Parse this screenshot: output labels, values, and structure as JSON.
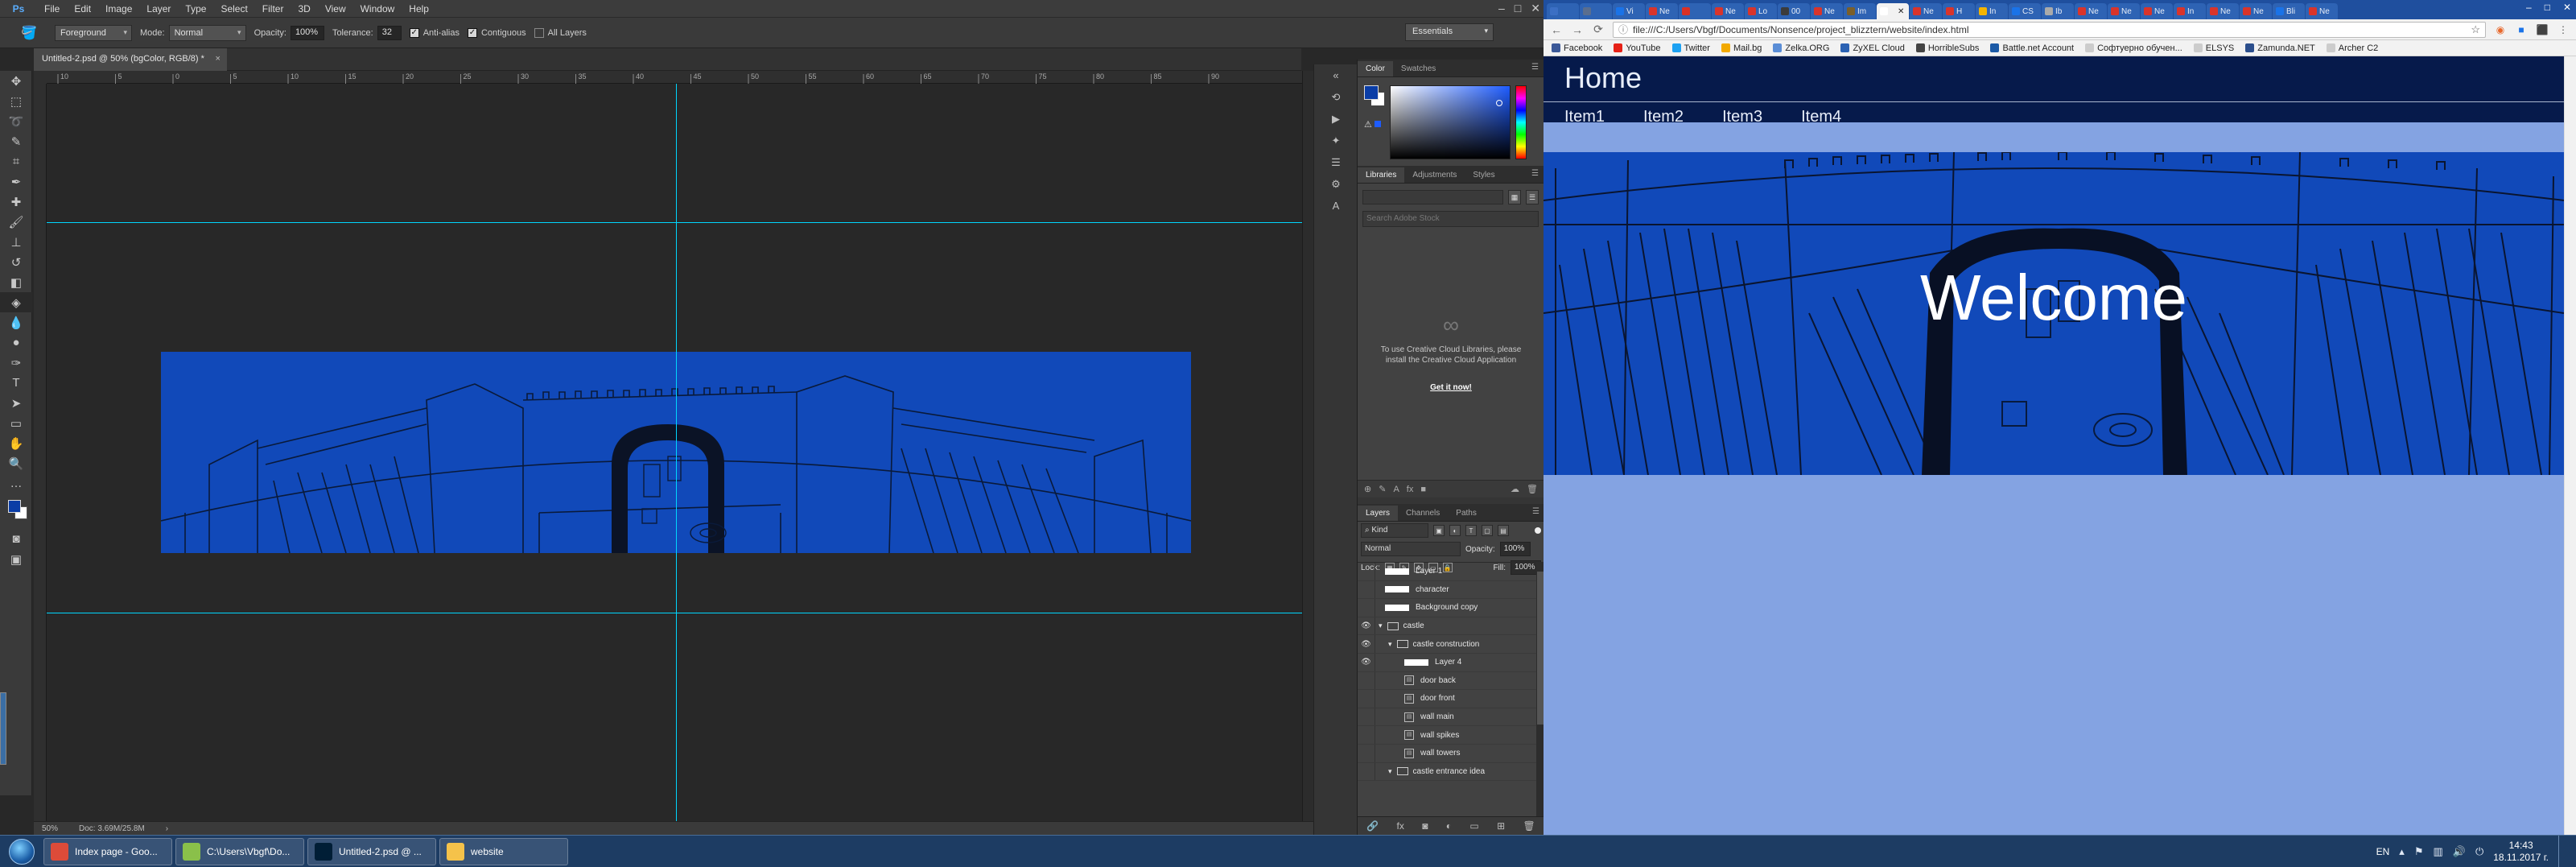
{
  "photoshop": {
    "menu": [
      "File",
      "Edit",
      "Image",
      "Layer",
      "Type",
      "Select",
      "Filter",
      "3D",
      "View",
      "Window",
      "Help"
    ],
    "options": {
      "fill_source": "Foreground",
      "mode_label": "Mode:",
      "mode_value": "Normal",
      "opacity_label": "Opacity:",
      "opacity_value": "100%",
      "tolerance_label": "Tolerance:",
      "tolerance_value": "32",
      "anti_alias": "Anti-alias",
      "contiguous": "Contiguous",
      "all_layers": "All Layers",
      "workspace": "Essentials"
    },
    "document_tab": "Untitled-2.psd @ 50% (bgColor, RGB/8) *",
    "document_tab_close": "×",
    "ruler_top_ticks": [
      "10",
      "5",
      "0",
      "5",
      "10",
      "15",
      "20",
      "25",
      "30",
      "35",
      "40",
      "45",
      "50",
      "55",
      "60",
      "65",
      "70",
      "75",
      "80",
      "85",
      "90"
    ],
    "status": {
      "zoom": "50%",
      "doc": "Doc: 3.69M/25.8M"
    },
    "color_panel": {
      "tabs": [
        "Color",
        "Swatches"
      ],
      "foreground": "#0a3da6",
      "background": "#ffffff"
    },
    "libraries_panel": {
      "tabs": [
        "Libraries",
        "Adjustments",
        "Styles"
      ],
      "search_placeholder": "Search Adobe Stock",
      "message": "To use Creative Cloud Libraries, please install the Creative Cloud Application",
      "link": "Get it now!"
    },
    "layers_panel": {
      "tabs": [
        "Layers",
        "Channels",
        "Paths"
      ],
      "kind": "Kind",
      "blend_mode": "Normal",
      "opacity_label": "Opacity:",
      "opacity_value": "100%",
      "lock_label": "Lock:",
      "fill_label": "Fill:",
      "fill_value": "100%",
      "layers": [
        {
          "name": "Layer 1",
          "visible": false,
          "kind": "pixel",
          "indent": 0
        },
        {
          "name": "character",
          "visible": false,
          "kind": "pixel",
          "indent": 0
        },
        {
          "name": "Background copy",
          "visible": false,
          "kind": "pixel",
          "indent": 0
        },
        {
          "name": "castle",
          "visible": true,
          "kind": "group",
          "indent": 0
        },
        {
          "name": "castle construction",
          "visible": true,
          "kind": "group",
          "indent": 1
        },
        {
          "name": "Layer 4",
          "visible": true,
          "kind": "pixel",
          "indent": 2
        },
        {
          "name": "door back",
          "visible": false,
          "kind": "smart",
          "indent": 2
        },
        {
          "name": "door front",
          "visible": false,
          "kind": "smart",
          "indent": 2
        },
        {
          "name": "wall main",
          "visible": false,
          "kind": "smart",
          "indent": 2
        },
        {
          "name": "wall spikes",
          "visible": false,
          "kind": "smart",
          "indent": 2
        },
        {
          "name": "wall towers",
          "visible": false,
          "kind": "smart",
          "indent": 2
        },
        {
          "name": "castle entrance idea",
          "visible": false,
          "kind": "group",
          "indent": 1
        }
      ]
    }
  },
  "chrome": {
    "address": "file:///C:/Users/Vbgf/Documents/Nonsence/project_blizztern/website/index.html",
    "tabs": [
      {
        "label": "",
        "color": "#3b6fc4"
      },
      {
        "label": "",
        "color": "#5a6e8f"
      },
      {
        "label": "Vi",
        "color": "#1a73e8"
      },
      {
        "label": "Ne",
        "color": "#d9342b"
      },
      {
        "label": "",
        "color": "#d93025"
      },
      {
        "label": "Ne",
        "color": "#d9342b"
      },
      {
        "label": "Lo",
        "color": "#d9342b"
      },
      {
        "label": "00",
        "color": "#3b3b3b"
      },
      {
        "label": "Ne",
        "color": "#d9342b"
      },
      {
        "label": "Im",
        "color": "#7a5f2a"
      },
      {
        "label": "",
        "color": "#ffffff"
      },
      {
        "label": "Ne",
        "color": "#d9342b"
      },
      {
        "label": "H",
        "color": "#d9342b"
      },
      {
        "label": "In",
        "color": "#f4b400"
      },
      {
        "label": "CS",
        "color": "#1a73e8"
      },
      {
        "label": "Ib",
        "color": "#aaaaaa"
      },
      {
        "label": "Ne",
        "color": "#d9342b"
      },
      {
        "label": "Ne",
        "color": "#d9342b"
      },
      {
        "label": "Ne",
        "color": "#d9342b"
      },
      {
        "label": "In",
        "color": "#d9342b"
      },
      {
        "label": "Ne",
        "color": "#d9342b"
      },
      {
        "label": "Ne",
        "color": "#d9342b"
      },
      {
        "label": "Bli",
        "color": "#1a73e8"
      },
      {
        "label": "Ne",
        "color": "#d9342b"
      }
    ],
    "active_tab_index": 10,
    "bookmarks": [
      {
        "label": "Facebook",
        "color": "#3b5998"
      },
      {
        "label": "YouTube",
        "color": "#e62117"
      },
      {
        "label": "Twitter",
        "color": "#1da1f2"
      },
      {
        "label": "Mail.bg",
        "color": "#f2a900"
      },
      {
        "label": "Zelka.ORG",
        "color": "#5a8dd6"
      },
      {
        "label": "ZyXEL Cloud",
        "color": "#2b62b3"
      },
      {
        "label": "HorribleSubs",
        "color": "#444444"
      },
      {
        "label": "Battle.net Account",
        "color": "#1c5aa6"
      },
      {
        "label": "Софтуерно обучен...",
        "color": "#cccccc"
      },
      {
        "label": "ELSYS",
        "color": "#cccccc"
      },
      {
        "label": "Zamunda.NET",
        "color": "#2b4e8c"
      },
      {
        "label": "Archer C2",
        "color": "#cccccc"
      }
    ]
  },
  "website": {
    "title": "Home",
    "nav": [
      "Item1",
      "Item2",
      "Item3",
      "Item4"
    ],
    "hero_text": "Welcome"
  },
  "taskbar": {
    "tasks": [
      {
        "label": "Index page - Goo...",
        "color": "#dd4b39"
      },
      {
        "label": "C:\\Users\\Vbgf\\Do...",
        "color": "#8ac04a"
      },
      {
        "label": "Untitled-2.psd @ ...",
        "color": "#001e36"
      },
      {
        "label": "website",
        "color": "#f5c24a"
      }
    ],
    "language": "EN",
    "time": "14:43",
    "date": "18.11.2017 г."
  }
}
